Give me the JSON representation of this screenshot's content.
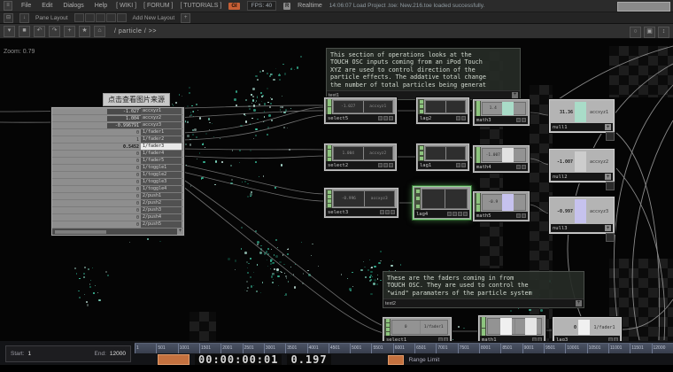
{
  "icons": {
    "window": "≡",
    "collapse": "⊟",
    "down_arrow": "↓",
    "chevron_down": "▾",
    "square": "■",
    "undo": "↶",
    "redo": "↷",
    "plus": "+",
    "star": "★",
    "home": "⌂",
    "circle": "○",
    "maximize": "▣",
    "updown": "↕",
    "realtime": "R"
  },
  "menubar": {
    "menus": [
      "File",
      "Edit",
      "Dialogs",
      "Help"
    ],
    "links": [
      "[ WIKI ]",
      "[ FORUM ]",
      "[ TUTORIALS ]"
    ],
    "badge": "GI",
    "fps_label": "FPS:",
    "fps_value": "40",
    "realtime_label": "Realtime",
    "status_message": "14:06:07 Load Project .toe: New.216.toe loaded successfully."
  },
  "layoutbar": {
    "pane_layout_label": "Pane Layout",
    "add_layout_label": "Add New Layout",
    "add_button": "+"
  },
  "pathbar": {
    "breadcrumb": "/ particle / >>"
  },
  "canvas": {
    "zoom_label": "Zoom: 0.79",
    "watermark": "点击查看图片来源",
    "comments": {
      "top": {
        "text": "This section of operations looks at the\nTOUCH OSC inputs coming from an iPod Touch\nXYZ are used to control direction of the\nparticle effects. The addative total change\nthe number of total particles being generat",
        "node_name": "text1"
      },
      "bottom": {
        "text": "These are the faders coming in from\nTOUCH OSC. They are used to control the\n\"wind\" paramaters of the particle system",
        "node_name": "text2"
      }
    },
    "chop_table": {
      "highlight_index": 5,
      "rows": [
        [
          "-1.027",
          "accxyz1"
        ],
        [
          "1.004",
          "accxyz2"
        ],
        [
          "-0.996791",
          "accxyz3"
        ],
        [
          "0",
          "1/fader1"
        ],
        [
          "1",
          "1/fader2"
        ],
        [
          "0.5452",
          "1/fader3"
        ],
        [
          "0",
          "1/fader4"
        ],
        [
          "0",
          "1/fader5"
        ],
        [
          "0",
          "1/toggle1"
        ],
        [
          "0",
          "1/toggle2"
        ],
        [
          "0",
          "1/toggle3"
        ],
        [
          "0",
          "1/toggle4"
        ],
        [
          "0",
          "2/push1"
        ],
        [
          "0",
          "2/push2"
        ],
        [
          "0",
          "2/push3"
        ],
        [
          "0",
          "2/push4"
        ],
        [
          "0",
          "2/push5"
        ]
      ]
    },
    "nodes": {
      "select5": {
        "name": "select5",
        "value": "-1.027",
        "channel": "accxyz1"
      },
      "lag2": {
        "name": "lag2"
      },
      "math3": {
        "name": "math3",
        "value": "1.4"
      },
      "null1": {
        "name": "null1",
        "value": "31.36",
        "channel": "accxyz1"
      },
      "select2": {
        "name": "select2",
        "value": "1.004",
        "channel": "accxyz2"
      },
      "lag1": {
        "name": "lag1"
      },
      "math4": {
        "name": "math4",
        "value": "-1.007"
      },
      "null2": {
        "name": "null2",
        "value": "-1.007",
        "channel": "accxyz2"
      },
      "select3": {
        "name": "select3",
        "value": "-0.996",
        "channel": "accxyz3"
      },
      "lag4": {
        "name": "lag4"
      },
      "math5": {
        "name": "math5",
        "value": "-0.9"
      },
      "null3": {
        "name": "null3",
        "value": "-0.997",
        "channel": "accxyz3"
      },
      "select1": {
        "name": "select1",
        "value": "0",
        "channel": "1/fader1"
      },
      "math1": {
        "name": "math1"
      },
      "lag3": {
        "name": "lag3",
        "value": "0",
        "channel": "1/fader1"
      }
    },
    "colors": {
      "teal_bar": "#a9dcc8",
      "gray_bar": "#cdcdcd",
      "lavender_bar": "#c6c2ee",
      "white_bar": "#e2e2e2",
      "connector_green": "#8dc47e",
      "selected_green": "#8ed88e",
      "orange_accent": "#c4713f",
      "particle_teal": "#43dcb4"
    }
  },
  "timeline": {
    "start_label": "Start:",
    "start_value": "1",
    "end_label": "End:",
    "end_value": "12000",
    "ticks": [
      "1",
      "501",
      "1001",
      "1501",
      "2001",
      "2501",
      "3001",
      "3501",
      "4001",
      "4501",
      "5001",
      "5501",
      "6001",
      "6501",
      "7001",
      "7501",
      "8001",
      "8501",
      "9001",
      "9501",
      "10001",
      "10501",
      "11001",
      "11501",
      "12000"
    ],
    "timecode": "00:00:00:01",
    "rate_value": "0.197",
    "range_limit_label": "Range Limit"
  }
}
